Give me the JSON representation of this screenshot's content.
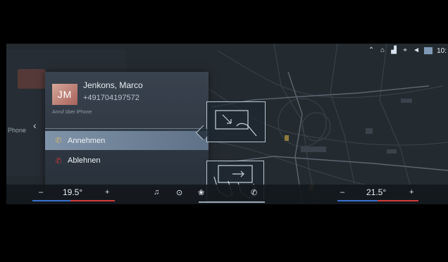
{
  "statusbar": {
    "icons": [
      "bluetooth-icon",
      "wifi-icon",
      "signal-icon",
      "gps-icon",
      "volume-icon",
      "weather-icon"
    ],
    "time": "10:"
  },
  "left_panel": {
    "label": "Phone"
  },
  "call": {
    "initials": "JM",
    "name": "Jenkons, Marco",
    "number": "+491704197572",
    "device": "Anruf über iPhone",
    "accept_label": "Annehmen",
    "decline_label": "Ablehnen",
    "accept_color": "#d2b466",
    "decline_color": "#c43a3a"
  },
  "climate": {
    "left": {
      "minus": "–",
      "value": "19.5°",
      "plus": "+"
    },
    "right": {
      "minus": "–",
      "value": "21.5°",
      "plus": "+"
    },
    "blue": "#3b6fd1",
    "red": "#d23b3b"
  },
  "controls": {
    "music": "♫",
    "nav": "⊙",
    "fan": "❀",
    "hvac": "☼",
    "phone": "✆"
  }
}
